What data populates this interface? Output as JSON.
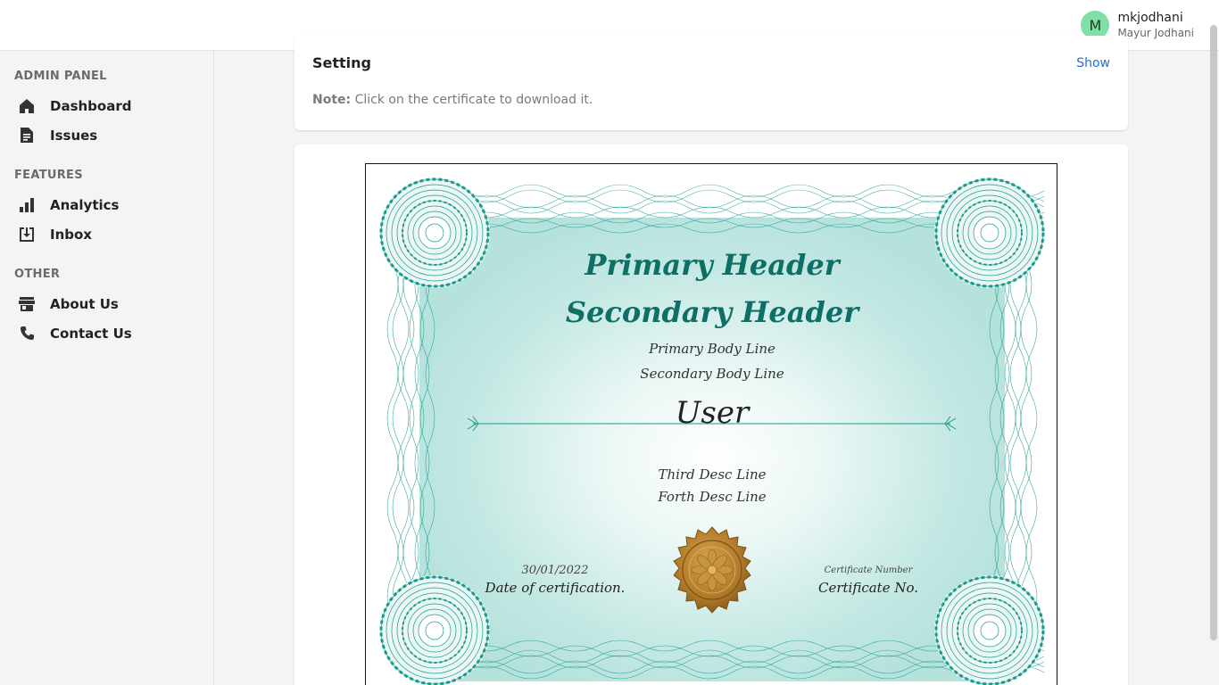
{
  "header": {
    "avatar_initial": "M",
    "username": "mkjodhani",
    "full_name": "Mayur Jodhani"
  },
  "sidebar": {
    "sections": [
      {
        "title": "ADMIN PANEL",
        "items": [
          {
            "label": "Dashboard",
            "icon": "home-icon"
          },
          {
            "label": "Issues",
            "icon": "document-icon"
          }
        ]
      },
      {
        "title": "FEATURES",
        "items": [
          {
            "label": "Analytics",
            "icon": "bar-chart-icon"
          },
          {
            "label": "Inbox",
            "icon": "inbox-download-icon"
          }
        ]
      },
      {
        "title": "OTHER",
        "items": [
          {
            "label": "About Us",
            "icon": "store-icon"
          },
          {
            "label": "Contact Us",
            "icon": "phone-icon"
          }
        ]
      }
    ]
  },
  "setting_card": {
    "title": "Setting",
    "show_label": "Show",
    "note_label": "Note:",
    "note_text": " Click on the certificate to download it."
  },
  "certificate": {
    "primary_header": "Primary Header",
    "secondary_header": "Secondary Header",
    "primary_body_line": "Primary Body Line",
    "secondary_body_line": "Secondary Body Line",
    "user_name": "User",
    "third_desc_line": "Third Desc Line",
    "forth_desc_line": "Forth Desc Line",
    "date_value": "30/01/2022",
    "date_label": "Date of certification.",
    "cert_number_value": "Certificate Number",
    "cert_number_label": "Certificate No.",
    "colors": {
      "accent": "#1a9a8e",
      "header_text": "#0e6f66",
      "seal": "#b27c2c"
    }
  }
}
